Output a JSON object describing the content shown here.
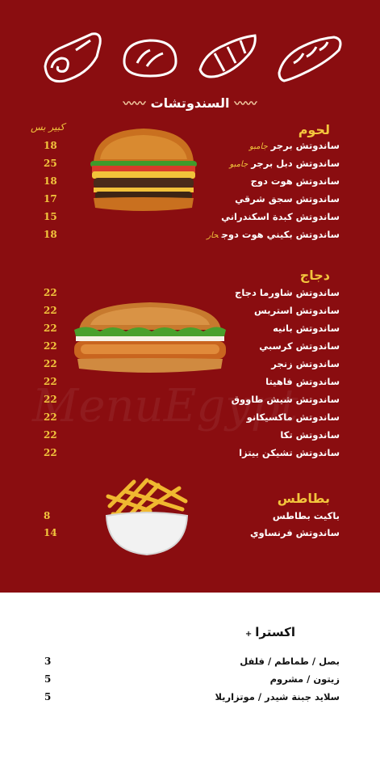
{
  "header": {
    "title": "السندوتشات",
    "size_label": "كبير بس"
  },
  "sections": [
    {
      "title": "لحوم",
      "items": [
        {
          "name": "ساندوتش برجر",
          "tag": "جامبو",
          "price": "18"
        },
        {
          "name": "ساندوتش دبل برجر",
          "tag": "جامبو",
          "price": "25"
        },
        {
          "name": "ساندوتش هوت دوج",
          "tag": "",
          "price": "18"
        },
        {
          "name": "ساندوتش سجق شرقي",
          "tag": "",
          "price": "17"
        },
        {
          "name": "ساندوتش كبدة اسكندراني",
          "tag": "",
          "price": "15"
        },
        {
          "name": "ساندوتش بكيني هوت دوج",
          "tag": "حار",
          "price": "18"
        }
      ]
    },
    {
      "title": "دجاج",
      "items": [
        {
          "name": "ساندوتش شاورما دجاج",
          "tag": "",
          "price": "22"
        },
        {
          "name": "ساندوتش استربس",
          "tag": "",
          "price": "22"
        },
        {
          "name": "ساندوتش بانيه",
          "tag": "",
          "price": "22"
        },
        {
          "name": "ساندوتش كرسبي",
          "tag": "",
          "price": "22"
        },
        {
          "name": "ساندوتش زنجر",
          "tag": "",
          "price": "22"
        },
        {
          "name": "ساندوتش فاهيتا",
          "tag": "",
          "price": "22"
        },
        {
          "name": "ساندوتش شيش طاووق",
          "tag": "",
          "price": "22"
        },
        {
          "name": "ساندوتش ماكسيكانو",
          "tag": "",
          "price": "22"
        },
        {
          "name": "ساندوتش تكا",
          "tag": "",
          "price": "22"
        },
        {
          "name": "ساندوتش تشيكن بيتزا",
          "tag": "",
          "price": "22"
        }
      ]
    },
    {
      "title": "بطاطس",
      "items": [
        {
          "name": "باكيت بطاطس",
          "tag": "",
          "price": "8"
        },
        {
          "name": "ساندوتش فرنساوي",
          "tag": "",
          "price": "14"
        }
      ]
    }
  ],
  "extras": {
    "title": "اكسترا",
    "items": [
      {
        "name": "بصل / طماطم / فلفل",
        "price": "3"
      },
      {
        "name": "زيتون / مشروم",
        "price": "5"
      },
      {
        "name": "سلايد جبنة شيدر / موتزاريلا",
        "price": "5"
      }
    ]
  },
  "watermark": "MenuEgypt",
  "colors": {
    "background": "#8a0d10",
    "accent": "#f2c53d",
    "text": "#ffffff"
  }
}
